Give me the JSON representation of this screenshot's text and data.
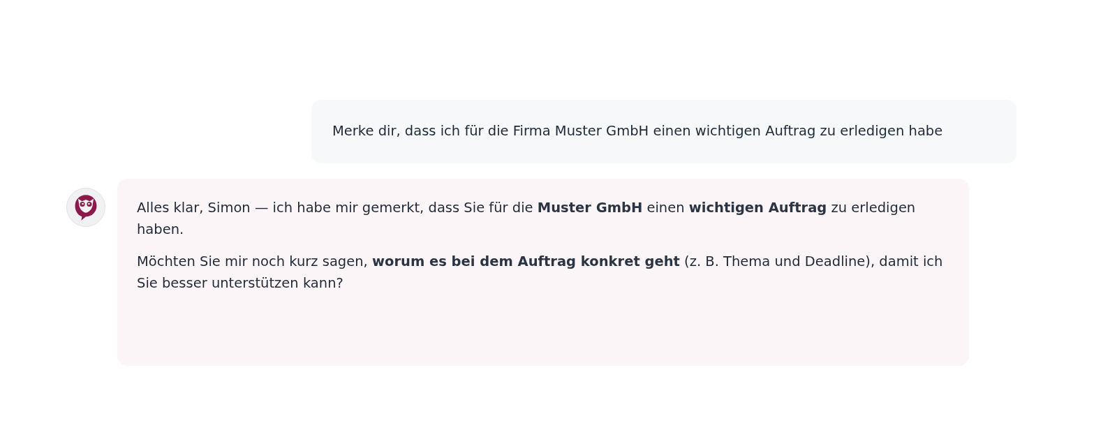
{
  "messages": [
    {
      "kind": "user",
      "paragraphs": [
        "Merke dir, dass ich für die Firma Muster GmbH einen wichtigen Auftrag zu erledigen habe"
      ]
    },
    {
      "kind": "assistant",
      "paragraphs": [
        "Alles klar, Simon — ich habe mir gemerkt, dass Sie für die **Muster GmbH** einen **wichtigen Auftrag** zu erledigen haben.",
        "Möchten Sie mir noch kurz sagen, **worum es bei dem Auftrag konkret geht** (z. B. Thema und Deadline), damit ich Sie besser unterstützen kann?"
      ]
    }
  ]
}
